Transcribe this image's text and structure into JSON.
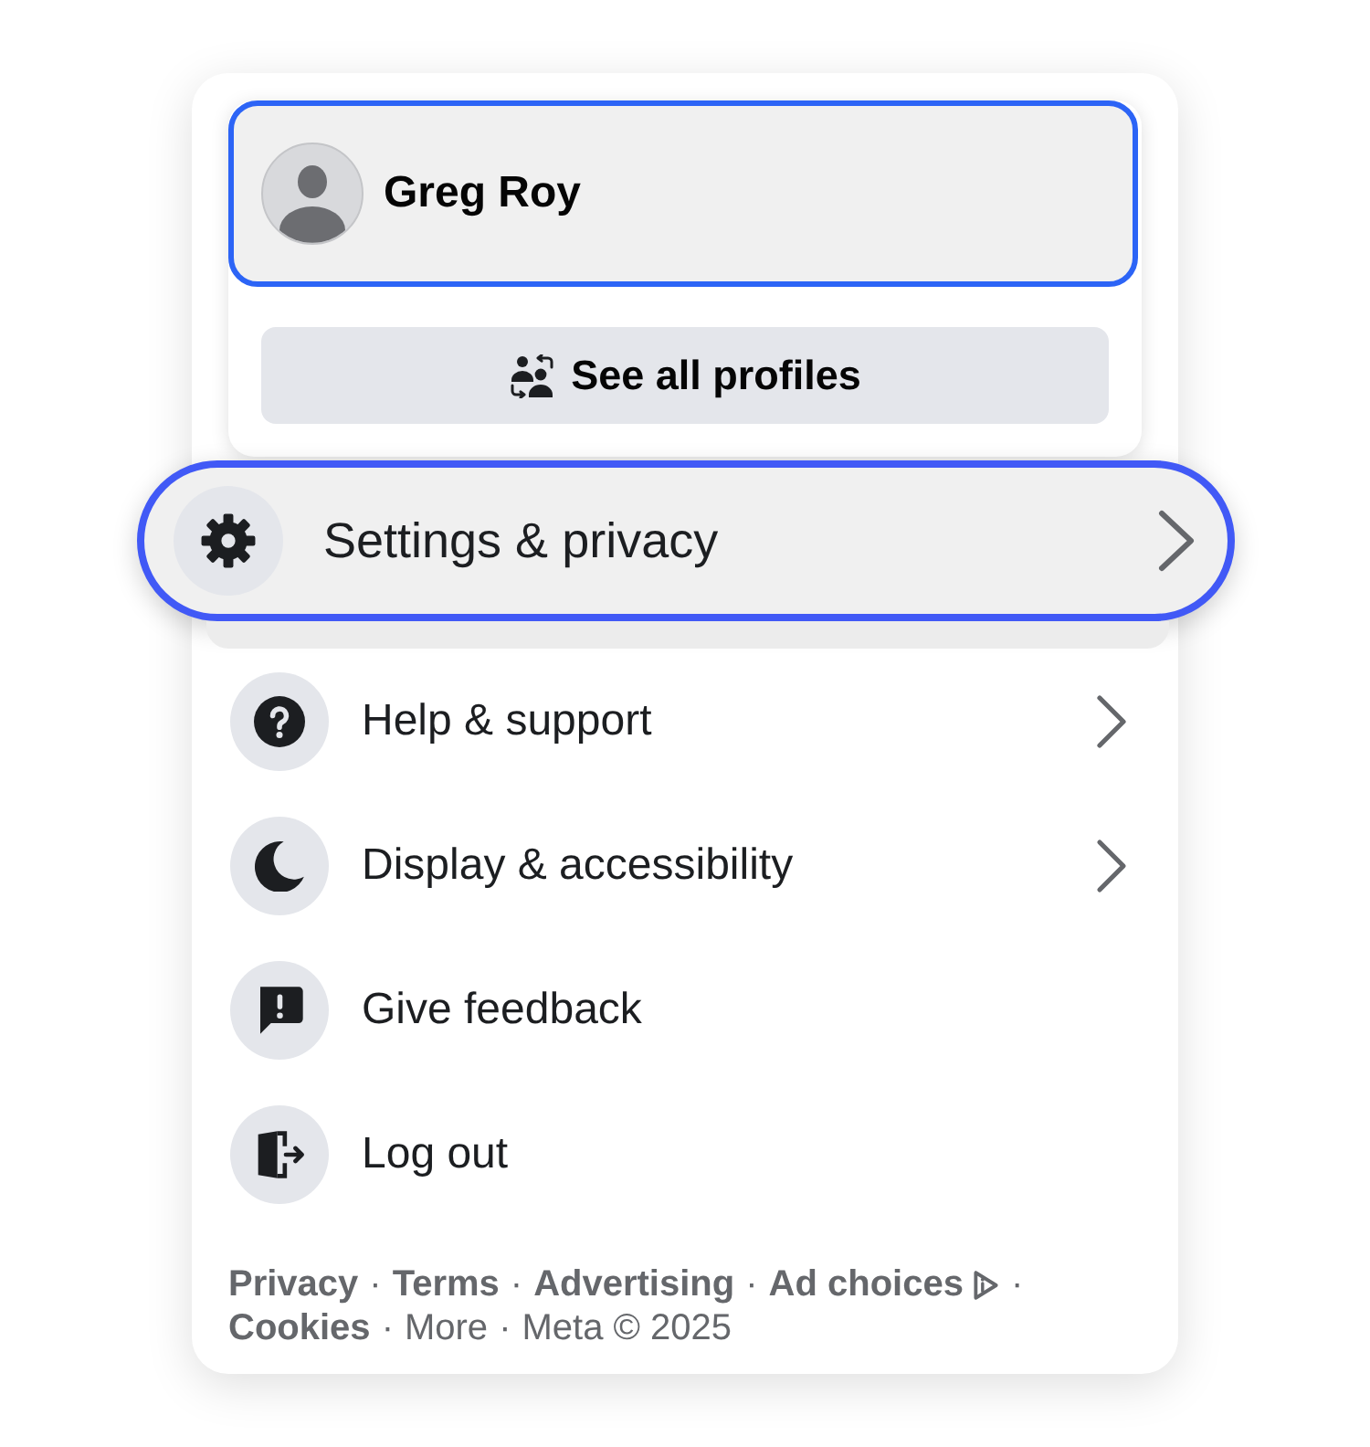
{
  "profile_switcher": {
    "profile": {
      "name": "Greg Roy",
      "selected": true
    },
    "see_all_button": {
      "label": "See all profiles"
    }
  },
  "menu_items": [
    {
      "label": "Settings & privacy",
      "selected": true,
      "has_submenu": true
    },
    {
      "label": "Help & support",
      "selected": false,
      "has_submenu": true
    },
    {
      "label": "Display & accessibility",
      "selected": false,
      "has_submenu": true
    },
    {
      "label": "Give feedback",
      "selected": false,
      "has_submenu": false
    },
    {
      "label": "Log out",
      "selected": false,
      "has_submenu": false
    }
  ],
  "footer": {
    "lines": [
      [
        {
          "kind": "link",
          "text": "Privacy"
        },
        {
          "kind": "separator",
          "text": "·"
        },
        {
          "kind": "link",
          "text": "Terms"
        },
        {
          "kind": "separator",
          "text": "·"
        },
        {
          "kind": "link",
          "text": "Advertising"
        },
        {
          "kind": "separator",
          "text": "·"
        },
        {
          "kind": "ad_link",
          "text": "Ad choices"
        },
        {
          "kind": "separator",
          "text": "·"
        }
      ],
      [
        {
          "kind": "link",
          "text": "Cookies"
        },
        {
          "kind": "separator",
          "text": "·"
        },
        {
          "kind": "plain_link",
          "text": "More"
        },
        {
          "kind": "separator",
          "text": "·"
        },
        {
          "kind": "text",
          "text": "Meta © 2025"
        }
      ]
    ]
  }
}
